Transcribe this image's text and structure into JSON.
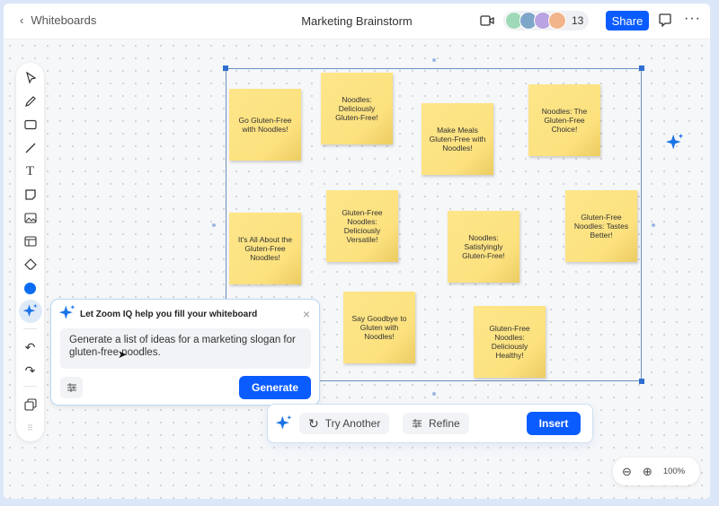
{
  "header": {
    "back_label": "Whiteboards",
    "title": "Marketing Brainstorm",
    "participant_count": "13",
    "share_label": "Share"
  },
  "notes": [
    "Go Gluten-Free with Noodles!",
    "Noodles: Deliciously Gluten-Free!",
    "Make Meals Gluten-Free with Noodles!",
    "Noodles: The Gluten-Free Choice!",
    "It's All About the Gluten-Free Noodles!",
    "Gluten-Free Noodles: Deliciously Versatile!",
    "Noodles: Satisfyingly Gluten-Free!",
    "Gluten-Free Noodles: Tastes Better!",
    "Say Goodbye to Gluten with Noodles!",
    "Gluten-Free Noodles: Deliciously Healthy!"
  ],
  "ai_panel": {
    "heading": "Let Zoom IQ help you fill your whiteboard",
    "prompt": "Generate a list of ideas for a marketing slogan for gluten-free noodles.",
    "generate_label": "Generate"
  },
  "result_bar": {
    "try_another_label": "Try Another",
    "refine_label": "Refine",
    "insert_label": "Insert"
  },
  "zoom": {
    "level": "100%"
  },
  "colors": {
    "accent": "#0b5cff",
    "sticky": "#fde68a",
    "ai_spark": "#1a73e8"
  }
}
